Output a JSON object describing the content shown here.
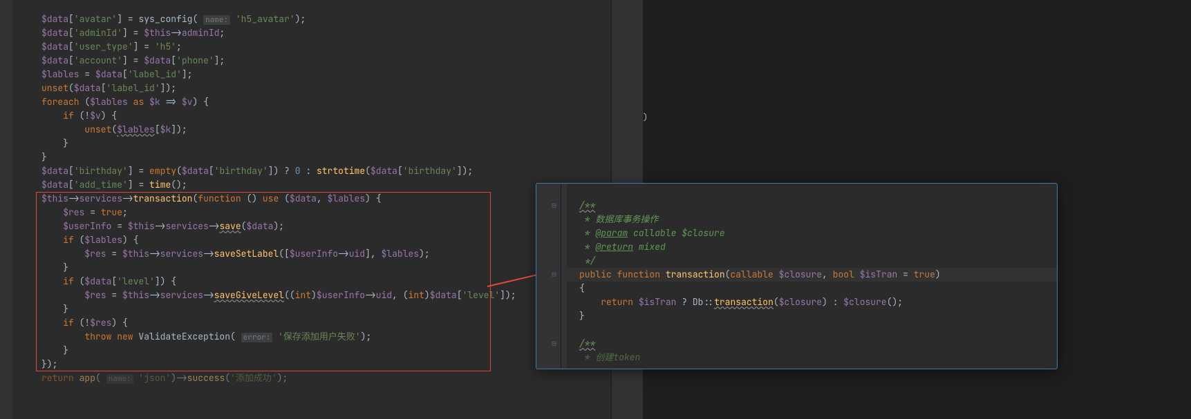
{
  "left": {
    "l1a": "$data",
    "l1b": "'avatar'",
    "l1c": "= sys_config(",
    "l1h": "name:",
    "l1d": "'h5_avatar'",
    "l1e": ");",
    "l2a": "$data",
    "l2b": "'adminId'",
    "l2c": "$this",
    "l2d": "adminId",
    "l3a": "$data",
    "l3b": "'user_type'",
    "l3c": "'h5'",
    "l4a": "$data",
    "l4b": "'account'",
    "l4c": "$data",
    "l4d": "'phone'",
    "l5a": "$lables",
    "l5b": "$data",
    "l5c": "'label_id'",
    "l6a": "unset",
    "l6b": "$data",
    "l6c": "'label_id'",
    "l7a": "foreach",
    "l7b": "$lables",
    "l7c": "as",
    "l7d": "$k",
    "l7e": "$v",
    "l8a": "if",
    "l8b": "$v",
    "l9a": "unset",
    "l9b": "$lables",
    "l9c": "$k",
    "l12a": "$data",
    "l12b": "'birthday'",
    "l12c": "empty",
    "l12d": "$data",
    "l12e": "'birthday'",
    "l12f": "0",
    "l12g": "strtotime",
    "l12h": "$data",
    "l12i": "'birthday'",
    "l13a": "$data",
    "l13b": "'add_time'",
    "l13c": "time",
    "l14a": "$this",
    "l14b": "services",
    "l14c": "transaction",
    "l14d": "function",
    "l14e": "use",
    "l14f": "$data",
    "l14g": "$lables",
    "l15a": "$res",
    "l15b": "true",
    "l16a": "$userInfo",
    "l16b": "$this",
    "l16c": "services",
    "l16d": "save",
    "l16e": "$data",
    "l17a": "if",
    "l17b": "$lables",
    "l18a": "$res",
    "l18b": "$this",
    "l18c": "services",
    "l18d": "saveSetLabel",
    "l18e": "$userInfo",
    "l18f": "uid",
    "l18g": "$lables",
    "l20a": "if",
    "l20b": "$data",
    "l20c": "'level'",
    "l21a": "$res",
    "l21b": "$this",
    "l21c": "services",
    "l21d": "saveGiveLevel",
    "l21e": "int",
    "l21f": "$userInfo",
    "l21g": "uid",
    "l21h": "int",
    "l21i": "$data",
    "l21j": "'level'",
    "l23a": "if",
    "l23b": "$res",
    "l24a": "throw new",
    "l24b": "ValidateException",
    "l24h": "error:",
    "l24c": "'保存添加用户失败'",
    "l27a": "return",
    "l27b": "app",
    "l27h": "name:",
    "l27c": "'json'",
    "l27d": "success",
    "l27e": "'添加成功'"
  },
  "popup": {
    "d1": "/**",
    "d2": " * 数据库事务操作",
    "d3a": " * ",
    "d3b": "@param",
    "d3c": " callable $closure",
    "d4a": " * ",
    "d4b": "@return",
    "d4c": " mixed",
    "d5": " */",
    "f1": "public function",
    "f2": "transaction",
    "f3": "callable",
    "f4": "$closure",
    "f5": "bool",
    "f6": "$isTran",
    "f7": "true",
    "b1": "return",
    "b2": "$isTran",
    "b3": "Db",
    "b4": "transaction",
    "b5": "$closure",
    "b6": "$closure",
    "d6": "/**",
    "d7": " * 创建token"
  },
  "misc": {
    "brace": ")"
  }
}
